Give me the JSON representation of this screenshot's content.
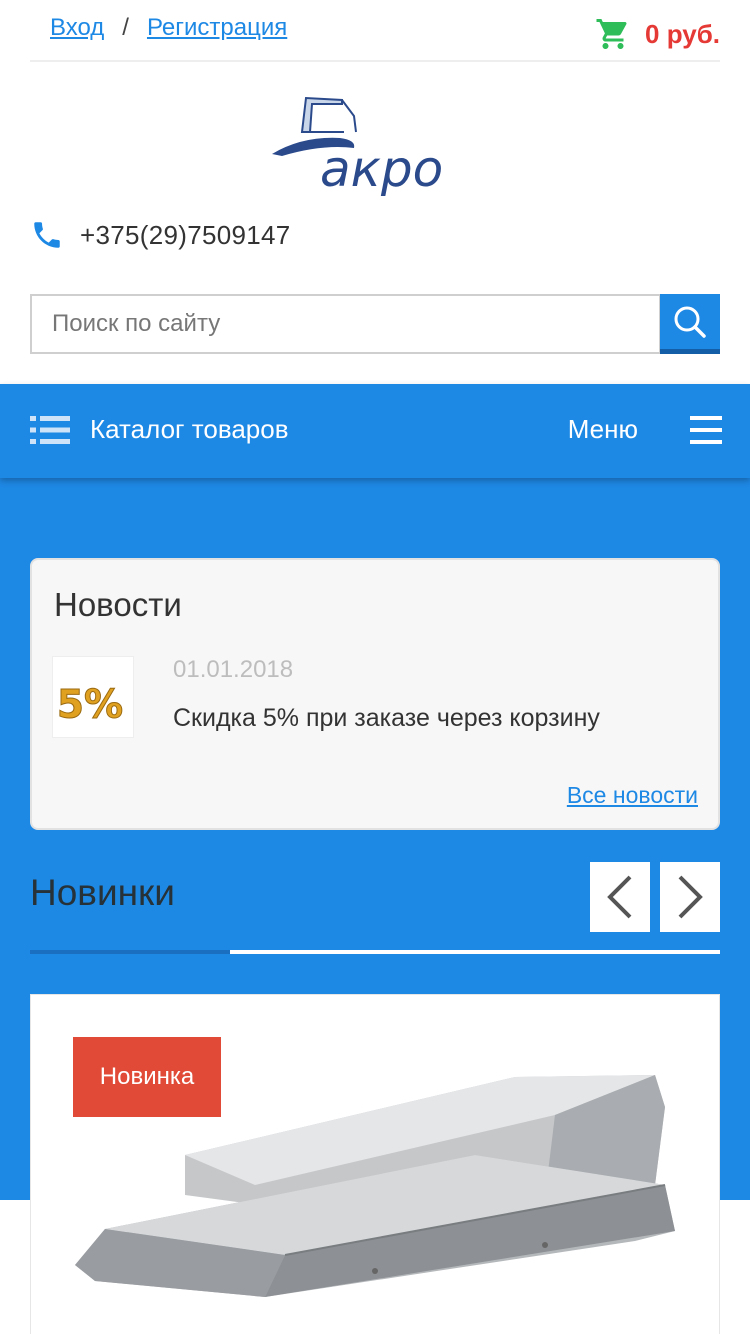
{
  "header": {
    "login_label": "Вход",
    "separator": "/",
    "register_label": "Регистрация",
    "cart_total": "0 руб.",
    "cart_icon": "cart-icon"
  },
  "logo": {
    "text": "акро"
  },
  "contacts": {
    "phone": "+375(29)7509147",
    "phone_icon": "phone-icon"
  },
  "search": {
    "placeholder": "Поиск по сайту",
    "value": "",
    "button_icon": "search-icon"
  },
  "nav": {
    "catalog_label": "Каталог товаров",
    "menu_label": "Меню",
    "catalog_icon": "list-icon",
    "menu_icon": "hamburger-icon"
  },
  "news": {
    "title": "Новости",
    "items": [
      {
        "date": "01.01.2018",
        "text": "Скидка 5% при заказе через корзину",
        "thumb_text": "5%"
      }
    ],
    "all_link": "Все новости"
  },
  "new_products": {
    "title": "Новинки",
    "items": [
      {
        "badge": "Новинка"
      }
    ]
  },
  "colors": {
    "primary": "#1e88e5",
    "badge": "#e04a36",
    "cart_icon": "#2ebd59",
    "cart_sum": "#e53935"
  }
}
